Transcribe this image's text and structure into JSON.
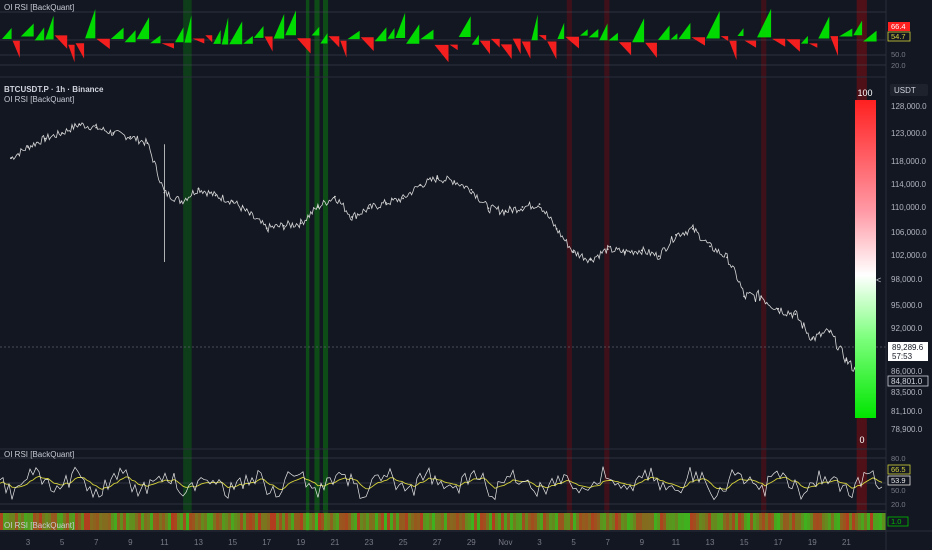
{
  "header": {
    "top_pane_title": "OI RSI [BackQuant]",
    "symbol_line": "BTCUSDT.P · 1h · Binance",
    "indicator_line": "OI RSI [BackQuant]",
    "currency_badge": "USDT",
    "rsi_pane_title": "OI RSI [BackQuant]",
    "heat_pane_title": "OI RSI [BackQuant]"
  },
  "colors": {
    "background": "#131722",
    "price_line": "#d8d8d8",
    "bull": "#00e500",
    "bear": "#ff2020",
    "rsi_line": "#e8e8e8",
    "signal_line": "#d5d23a",
    "grid_text": "#787b86"
  },
  "gauge": {
    "top_label": "100",
    "bottom_label": "0",
    "pointer": "<"
  },
  "price_axis": {
    "ticks": [
      "128,000.0",
      "123,000.0",
      "118,000.0",
      "114,000.0",
      "110,000.0",
      "106,000.0",
      "102,000.0",
      "98,000.0",
      "95,000.0",
      "92,000.0",
      "86,000.0",
      "83,500.0",
      "81,100.0",
      "78,900.0"
    ],
    "last_price": "89,289.6",
    "countdown": "57:53",
    "marker_price": "84,801.0"
  },
  "top_pane_axis": {
    "badge_red": "66.4",
    "badge_yellow": "54.7",
    "level_50": "50.0",
    "level_20": "20.0"
  },
  "rsi_pane_axis": {
    "level_80": "80.0",
    "badge_yellow": "66.5",
    "badge_white": "53.9",
    "level_50": "50.0",
    "level_20": "20.0"
  },
  "heat_pane_axis": {
    "badge": "1.0"
  },
  "time_axis": {
    "labels": [
      "3",
      "5",
      "7",
      "9",
      "11",
      "13",
      "15",
      "17",
      "19",
      "21",
      "23",
      "25",
      "27",
      "29",
      "Nov",
      "3",
      "5",
      "7",
      "9",
      "11",
      "13",
      "15",
      "17",
      "19",
      "21"
    ]
  },
  "chart_data": {
    "type": "line",
    "title": "BTCUSDT.P · 1h · Binance",
    "xlabel": "",
    "ylabel": "",
    "x_ticks": [
      "3",
      "5",
      "7",
      "9",
      "11",
      "13",
      "15",
      "17",
      "19",
      "21",
      "23",
      "25",
      "27",
      "29",
      "Nov",
      "3",
      "5",
      "7",
      "9",
      "11",
      "13",
      "15",
      "17",
      "19",
      "21"
    ],
    "ylim": [
      78900,
      128000
    ],
    "series": [
      {
        "name": "BTCUSDT.P",
        "values": [
          {
            "x": "Oct 2",
            "y": 118500
          },
          {
            "x": "Oct 3",
            "y": 120500
          },
          {
            "x": "Oct 4",
            "y": 122000
          },
          {
            "x": "Oct 5",
            "y": 123000
          },
          {
            "x": "Oct 6",
            "y": 124600
          },
          {
            "x": "Oct 7",
            "y": 124000
          },
          {
            "x": "Oct 8",
            "y": 123000
          },
          {
            "x": "Oct 9",
            "y": 122300
          },
          {
            "x": "Oct 10",
            "y": 121200
          },
          {
            "x": "Oct 11",
            "y": 112500
          },
          {
            "x": "Oct 12",
            "y": 111000
          },
          {
            "x": "Oct 13",
            "y": 113200
          },
          {
            "x": "Oct 14",
            "y": 112000
          },
          {
            "x": "Oct 15",
            "y": 111000
          },
          {
            "x": "Oct 16",
            "y": 108800
          },
          {
            "x": "Oct 17",
            "y": 106600
          },
          {
            "x": "Oct 18",
            "y": 107000
          },
          {
            "x": "Oct 19",
            "y": 107400
          },
          {
            "x": "Oct 20",
            "y": 110000
          },
          {
            "x": "Oct 21",
            "y": 111800
          },
          {
            "x": "Oct 22",
            "y": 108400
          },
          {
            "x": "Oct 23",
            "y": 109800
          },
          {
            "x": "Oct 24",
            "y": 110700
          },
          {
            "x": "Oct 25",
            "y": 111500
          },
          {
            "x": "Oct 26",
            "y": 113800
          },
          {
            "x": "Oct 27",
            "y": 115000
          },
          {
            "x": "Oct 28",
            "y": 114500
          },
          {
            "x": "Oct 29",
            "y": 113000
          },
          {
            "x": "Oct 30",
            "y": 109800
          },
          {
            "x": "Oct 31",
            "y": 109300
          },
          {
            "x": "Nov 1",
            "y": 110000
          },
          {
            "x": "Nov 2",
            "y": 110500
          },
          {
            "x": "Nov 3",
            "y": 106500
          },
          {
            "x": "Nov 4",
            "y": 102500
          },
          {
            "x": "Nov 5",
            "y": 101200
          },
          {
            "x": "Nov 6",
            "y": 103000
          },
          {
            "x": "Nov 7",
            "y": 102500
          },
          {
            "x": "Nov 8",
            "y": 102800
          },
          {
            "x": "Nov 9",
            "y": 101800
          },
          {
            "x": "Nov 10",
            "y": 105500
          },
          {
            "x": "Nov 11",
            "y": 106500
          },
          {
            "x": "Nov 12",
            "y": 103500
          },
          {
            "x": "Nov 13",
            "y": 101600
          },
          {
            "x": "Nov 14",
            "y": 96000
          },
          {
            "x": "Nov 15",
            "y": 96000
          },
          {
            "x": "Nov 16",
            "y": 94500
          },
          {
            "x": "Nov 17",
            "y": 93800
          },
          {
            "x": "Nov 18",
            "y": 90500
          },
          {
            "x": "Nov 19",
            "y": 91500
          },
          {
            "x": "Nov 20",
            "y": 87500
          },
          {
            "x": "Nov 21",
            "y": 84800
          }
        ]
      }
    ],
    "grid": false,
    "legend": "none"
  }
}
